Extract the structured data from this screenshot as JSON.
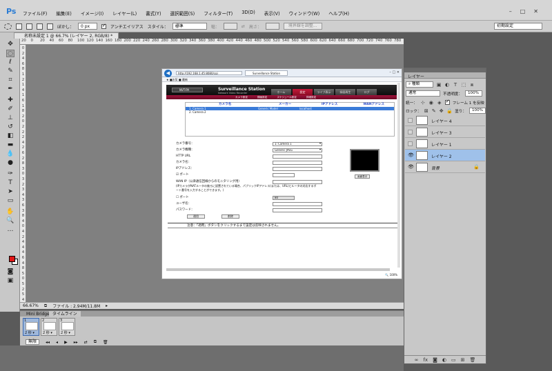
{
  "app": {
    "logo": "Ps",
    "menus": [
      "ファイル(F)",
      "編集(E)",
      "イメージ(I)",
      "レイヤー(L)",
      "書式(Y)",
      "選択範囲(S)",
      "フィルター(T)",
      "3D(D)",
      "表示(V)",
      "ウィンドウ(W)",
      "ヘルプ(H)"
    ],
    "window_controls": [
      "–",
      "□",
      "✕"
    ]
  },
  "options": {
    "feather_label": "ぼかし：",
    "feather_value": "0 px",
    "antialias_label": "アンチエイリアス",
    "style_label": "スタイル：",
    "style_value": "標準",
    "width_label": "幅：",
    "height_label": "高さ：",
    "refine_edge": "境界線を調整...",
    "workspace": "初期設定"
  },
  "document": {
    "tab_title": "名称未設定 1 @ 66.7% (レイヤー 2, RGB/8) *",
    "zoom": "66.67%",
    "file_info": "ファイル : 2.94M/11.8M"
  },
  "rulers": {
    "h": [
      "20",
      "0",
      "20",
      "40",
      "60",
      "80",
      "100",
      "120",
      "140",
      "160",
      "180",
      "200",
      "220",
      "240",
      "260",
      "280",
      "300",
      "320",
      "340",
      "360",
      "380",
      "400",
      "420",
      "440",
      "460",
      "480",
      "500",
      "520",
      "540",
      "560",
      "580",
      "600",
      "620",
      "640",
      "660",
      "680",
      "700",
      "720",
      "740",
      "760",
      "780"
    ],
    "v": [
      "0",
      "2",
      "4",
      "6",
      "8",
      "1",
      "2",
      "1",
      "4",
      "1",
      "6",
      "1",
      "8",
      "2",
      "0",
      "2",
      "2",
      "2",
      "4",
      "2",
      "6",
      "2",
      "8",
      "3",
      "0",
      "3",
      "2",
      "3",
      "4",
      "3",
      "6",
      "3",
      "8",
      "4",
      "0",
      "4",
      "2",
      "4",
      "4",
      "4",
      "6",
      "4",
      "8",
      "5",
      "0",
      "5",
      "2",
      "5",
      "4"
    ]
  },
  "browser": {
    "url": "http://192.168.1.45:8080/cgi",
    "tab": "Surveillance Station",
    "fav": "★ ■お気 ■ 最新",
    "header_select": "NVT-PA",
    "logo": "Surveillance Station",
    "logo_sub": "Network Video Recorder",
    "tabs": [
      "ホーム",
      "設定",
      "ライブ表示",
      "録画再生",
      "ログ"
    ],
    "subtabs": [
      "カメラ設定",
      "録画設定",
      "スケジュール設定",
      "詳細設定"
    ],
    "table_headers": [
      "カメラ名",
      "メーカー",
      "IPアドレス",
      "WANアドレス"
    ],
    "rows": [
      [
        "1.  Camera 1",
        "Generic Model",
        "localhost",
        ""
      ],
      [
        "2.  Camera 2",
        "",
        "",
        ""
      ]
    ],
    "form": {
      "cam_no_label": "カメラ番号：",
      "cam_no_value": "1: Camera 1",
      "model_label": "カメラ機種：",
      "model_value": "Generic JPEG",
      "http_url_label": "HTTP URL",
      "cam_name_label": "カメラ名：",
      "ip_label": "IPアドレス：",
      "port_label": "ポート",
      "wan_label": "WAN IP（公衆通信回線からのモニタリング用）",
      "wan_note": "(IPカメラがNATルータの後ろに設置されている場合、パブリックIPアドレス(または、URL)とルータの対応するポート番号を入力することができます。)",
      "wan_port_label": "ポート",
      "wan_port_value": "80",
      "user_label": "ユーザ名：",
      "pass_label": "パスワード：",
      "apply": "適用",
      "cancel": "削除",
      "display_btn": "画面表示"
    },
    "note": "注意：「適用」ボタンをクリックするまで設定は反映されません。",
    "zoom": "🔍 100%"
  },
  "timeline": {
    "tabs": [
      "Mini Bridge",
      "タイムライン"
    ],
    "frames": [
      {
        "num": "1",
        "sec": "2 秒 ▾"
      },
      {
        "num": "2",
        "sec": "2 秒 ▾"
      },
      {
        "num": "3",
        "sec": "2 秒 ▾"
      }
    ],
    "loop": "無限",
    "controls": [
      "◂◂",
      "◂",
      "▶",
      "▸▸",
      "⇄",
      "⧉",
      "🗑"
    ]
  },
  "layers": {
    "title": "レイヤー",
    "kind_value": "種類",
    "blend_value": "通常",
    "opacity_label": "不透明度：",
    "opacity_value": "100%",
    "unify_label": "統一：",
    "frame_label": "フレーム 1 を反映",
    "lock_label": "ロック：",
    "fill_label": "塗り：",
    "fill_value": "100%",
    "items": [
      {
        "name": "レイヤー 4",
        "visible": false,
        "selected": false
      },
      {
        "name": "レイヤー 3",
        "visible": false,
        "selected": false
      },
      {
        "name": "レイヤー 1",
        "visible": false,
        "selected": false
      },
      {
        "name": "レイヤー 2",
        "visible": true,
        "selected": true
      },
      {
        "name": "背景",
        "visible": true,
        "selected": false,
        "locked": true
      }
    ],
    "footer_icons": [
      "link-icon",
      "fx-icon",
      "mask-icon",
      "adjustment-icon",
      "folder-icon",
      "new-layer-icon",
      "trash-icon"
    ]
  },
  "colors": {
    "accent": "#2b7cd4",
    "foreground": "#e01515",
    "background": "#ffffff",
    "selection": "#9fc1ea",
    "brand_tab": "#c4193a"
  }
}
